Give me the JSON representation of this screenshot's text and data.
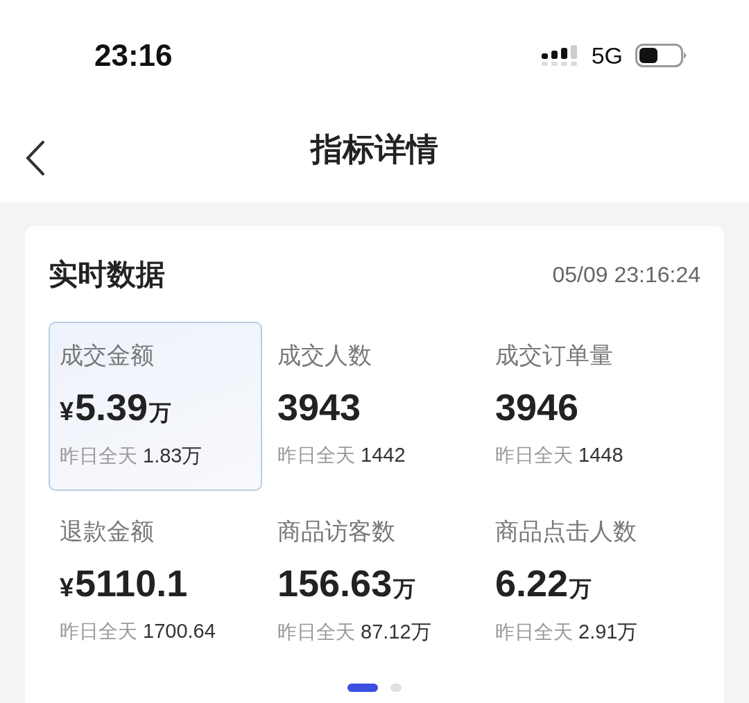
{
  "status_bar": {
    "time": "23:16",
    "network": "5G"
  },
  "nav": {
    "title": "指标详情"
  },
  "card": {
    "title": "实时数据",
    "timestamp": "05/09 23:16:24",
    "metrics": [
      {
        "label": "成交金额",
        "prefix": "¥",
        "value": "5.39",
        "unit": "万",
        "yesterday_label": "昨日全天",
        "yesterday_value": "1.83万",
        "selected": true
      },
      {
        "label": "成交人数",
        "value": "3943",
        "yesterday_label": "昨日全天",
        "yesterday_value": "1442",
        "selected": false
      },
      {
        "label": "成交订单量",
        "value": "3946",
        "yesterday_label": "昨日全天",
        "yesterday_value": "1448",
        "selected": false
      },
      {
        "label": "退款金额",
        "prefix": "¥",
        "value": "5110.1",
        "yesterday_label": "昨日全天",
        "yesterday_value": "1700.64",
        "selected": false
      },
      {
        "label": "商品访客数",
        "value": "156.63",
        "unit": "万",
        "yesterday_label": "昨日全天",
        "yesterday_value": "87.12万",
        "selected": false
      },
      {
        "label": "商品点击人数",
        "value": "6.22",
        "unit": "万",
        "yesterday_label": "昨日全天",
        "yesterday_value": "2.91万",
        "selected": false
      }
    ],
    "pages": [
      {
        "selected": true
      },
      {
        "selected": false
      }
    ]
  }
}
